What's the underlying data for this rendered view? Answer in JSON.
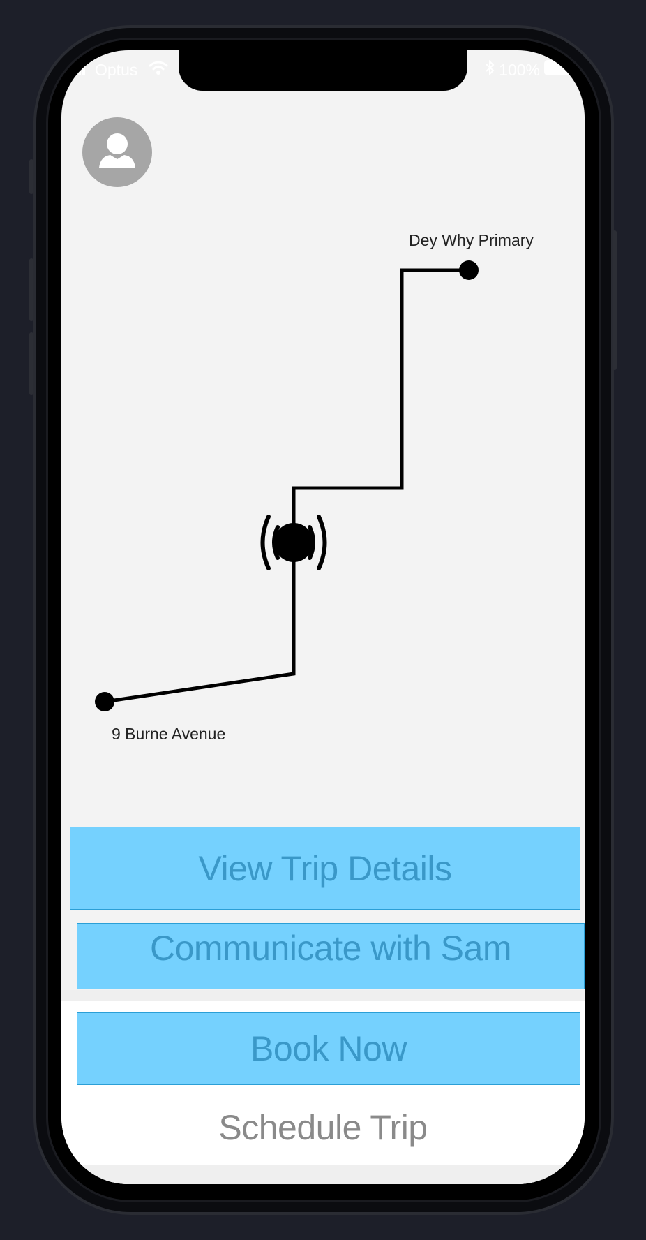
{
  "status_bar": {
    "carrier": "Optus",
    "battery": "100%"
  },
  "map": {
    "destination_label": "Dey Why Primary",
    "origin_label": "9 Burne Avenue"
  },
  "actions": {
    "view_trip_details": "View Trip Details",
    "communicate": "Communicate with Sam",
    "book_now": "Book Now",
    "schedule_trip": "Schedule Trip"
  },
  "colors": {
    "button_fill": "#75d1fe",
    "button_border": "#2b9fd6",
    "button_text": "#3a98c8"
  }
}
